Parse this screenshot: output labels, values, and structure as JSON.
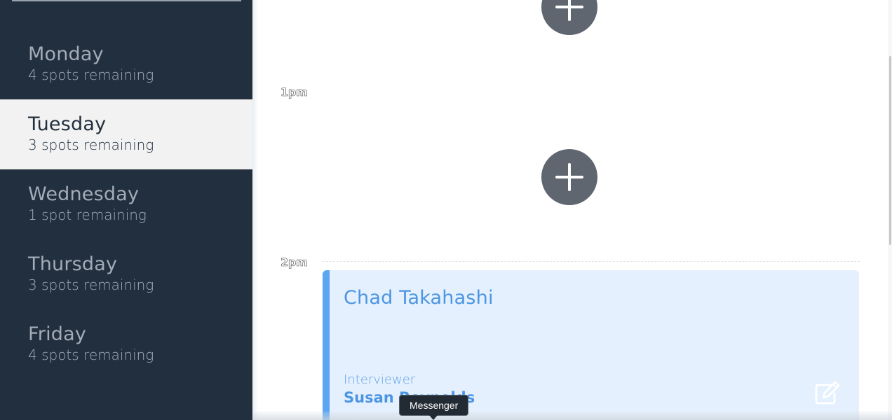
{
  "sidebar": {
    "days": [
      {
        "name": "Monday",
        "spots": "4 spots remaining",
        "selected": false
      },
      {
        "name": "Tuesday",
        "spots": "3 spots remaining",
        "selected": true
      },
      {
        "name": "Wednesday",
        "spots": "1 spot remaining",
        "selected": false
      },
      {
        "name": "Thursday",
        "spots": "3 spots remaining",
        "selected": false
      },
      {
        "name": "Friday",
        "spots": "4 spots remaining",
        "selected": false
      }
    ]
  },
  "schedule": {
    "times": [
      "1pm",
      "2pm"
    ],
    "appointment": {
      "student": "Chad Takahashi",
      "interviewer_label": "Interviewer",
      "interviewer": "Susan Reynolds"
    }
  },
  "tooltip": {
    "text": "Messenger"
  },
  "colors": {
    "sidebar_bg": "#222f3e",
    "selected_bg": "#f2f2f2",
    "accent_blue": "#5aa6f2",
    "card_bg": "#e4f0fd",
    "add_button": "#5f6670"
  },
  "icons": {
    "add": "plus-icon",
    "edit": "edit-icon"
  }
}
